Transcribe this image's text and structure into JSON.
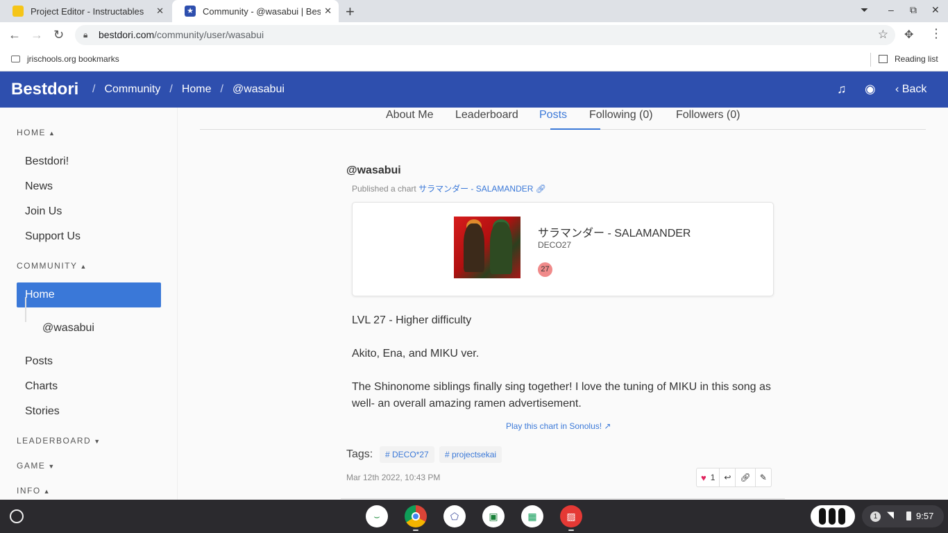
{
  "browser": {
    "tabs": [
      {
        "title": "Project Editor - Instructables",
        "favicon_color": "#f5c518"
      },
      {
        "title": "Community - @wasabui | Bestdori",
        "favicon_color": "#2e4fae"
      }
    ],
    "url_domain": "bestdori.com",
    "url_path": "/community/user/wasabui",
    "bookmark": "jrischools.org bookmarks",
    "reading_list": "Reading list"
  },
  "site": {
    "brand": "Bestdori",
    "breadcrumbs": [
      "Community",
      "Home",
      "@wasabui"
    ],
    "back_label": "Back",
    "header_color": "#2e4fae"
  },
  "sidebar": {
    "sections": {
      "home": "HOME",
      "community": "COMMUNITY",
      "leaderboard": "LEADERBOARD",
      "game": "GAME",
      "info": "INFO"
    },
    "home_items": [
      "Bestdori!",
      "News",
      "Join Us",
      "Support Us"
    ],
    "community_active": "Home",
    "community_sub": "@wasabui",
    "community_items": [
      "Posts",
      "Charts",
      "Stories"
    ]
  },
  "profile_tabs": [
    "About Me",
    "Leaderboard",
    "Posts",
    "Following (0)",
    "Followers (0)"
  ],
  "active_tab": "Posts",
  "post": {
    "author": "@wasabui",
    "published_prefix": "Published a chart",
    "chart_link": "サラマンダー - SALAMANDER",
    "song_title": "サラマンダー - SALAMANDER",
    "artist": "DECO27",
    "level": "27",
    "body": [
      "LVL 27 - Higher difficulty",
      "Akito, Ena, and MIKU ver.",
      "The Shinonome siblings finally sing together! I love the tuning of MIKU in this song as well- an overall amazing ramen advertisement."
    ],
    "play_link": "Play this chart in Sonolus!",
    "tags_label": "Tags:",
    "tags": [
      "# DECO*27",
      "# projectsekai"
    ],
    "date": "Mar 12th 2022, 10:43 PM",
    "likes": "1"
  },
  "shelf": {
    "notifications": "1",
    "time": "9:57"
  }
}
